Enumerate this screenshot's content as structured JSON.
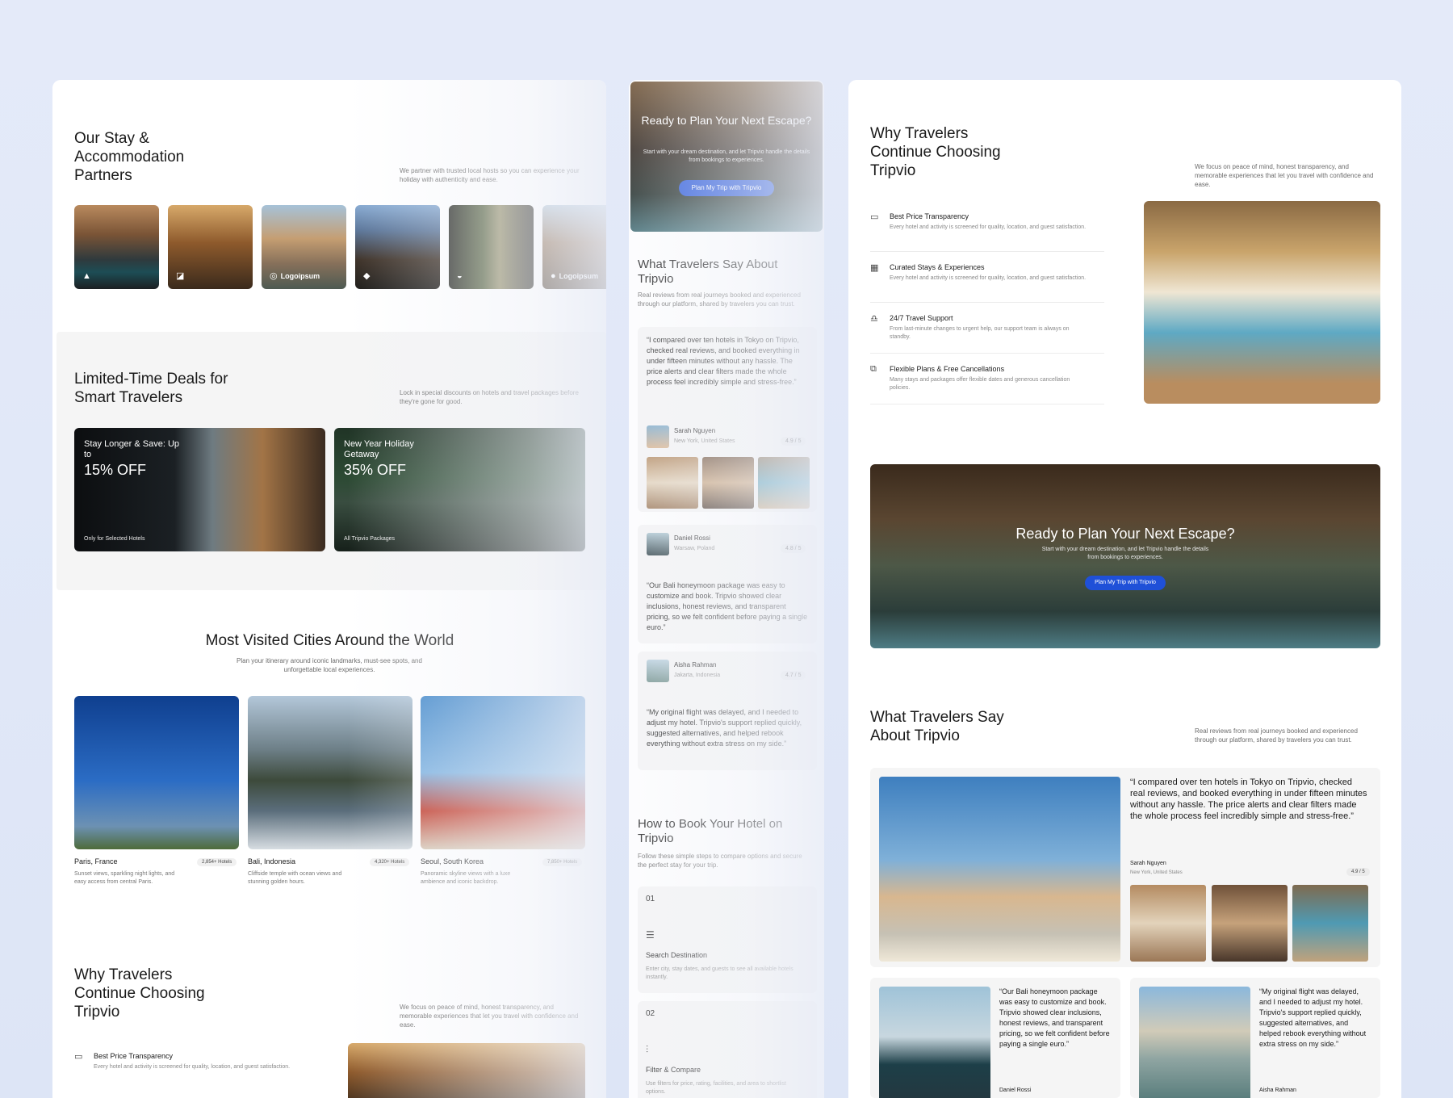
{
  "partners": {
    "title": "Our Stay & Accommodation Partners",
    "desc": "We partner with trusted local hosts so you can experience your holiday with authenticity and ease.",
    "logos": [
      "",
      "",
      "Logoipsum",
      "",
      "",
      "Logoipsum"
    ]
  },
  "deals": {
    "title": "Limited-Time Deals for Smart Travelers",
    "desc": "Lock in special discounts on hotels and travel packages before they're gone for good.",
    "cards": [
      {
        "title": "Stay Longer & Save: Up to",
        "pct": "15% OFF",
        "foot": "Only for Selected Hotels"
      },
      {
        "title": "New Year Holiday Getaway",
        "pct": "35% OFF",
        "foot": "All Tripvio Packages"
      }
    ]
  },
  "cities": {
    "title": "Most Visited Cities Around the World",
    "desc": "Plan your itinerary around iconic landmarks, must-see spots, and unforgettable local experiences.",
    "items": [
      {
        "name": "Paris, France",
        "badge": "2,854+ Hotels",
        "desc": "Sunset views, sparkling night lights, and easy access from central Paris."
      },
      {
        "name": "Bali, Indonesia",
        "badge": "4,320+ Hotels",
        "desc": "Cliffside temple with ocean views and stunning golden hours."
      },
      {
        "name": "Seoul, South Korea",
        "badge": "7,850+ Hotels",
        "desc": "Panoramic skyline views with a luxe ambience and iconic backdrop."
      }
    ]
  },
  "why": {
    "title": "Why Travelers Continue Choosing Tripvio",
    "desc": "We focus on peace of mind, honest transparency, and memorable experiences that let you travel with confidence and ease.",
    "features": [
      {
        "title": "Best Price Transparency",
        "desc": "Every hotel and activity is screened for quality, location, and guest satisfaction.",
        "icon": "cash-icon"
      },
      {
        "title": "Curated Stays & Experiences",
        "desc": "Every hotel and activity is screened for quality, location, and guest satisfaction.",
        "icon": "building-icon"
      },
      {
        "title": "24/7 Travel Support",
        "desc": "From last-minute changes to urgent help, our support team is always on standby.",
        "icon": "headset-icon"
      },
      {
        "title": "Flexible Plans & Free Cancellations",
        "desc": "Many stays and packages offer flexible dates and generous cancellation policies.",
        "icon": "copy-icon"
      }
    ]
  },
  "cta": {
    "title": "Ready to Plan Your Next Escape?",
    "desc": "Start with your dream destination, and let Tripvio handle the details from bookings to experiences.",
    "button": "Plan My Trip with Tripvio"
  },
  "reviews": {
    "title": "What Travelers Say About Tripvio",
    "desc": "Real reviews from real journeys booked and experienced through our platform, shared by travelers you can trust.",
    "items": [
      {
        "quote": "“I compared over ten hotels in Tokyo on Tripvio, checked real reviews, and booked everything in under fifteen minutes without any hassle. The price alerts and clear filters made the whole process feel incredibly simple and stress-free.”",
        "name": "Sarah Nguyen",
        "loc": "New York, United States",
        "rating": "4.9 / 5"
      },
      {
        "quote": "“Our Bali honeymoon package was easy to customize and book. Tripvio showed clear inclusions, honest reviews, and transparent pricing, so we felt confident before paying a single euro.”",
        "name": "Daniel Rossi",
        "loc": "Warsaw, Poland",
        "rating": "4.8 / 5"
      },
      {
        "quote": "“My original flight was delayed, and I needed to adjust my hotel. Tripvio's support replied quickly, suggested alternatives, and helped rebook everything without extra stress on my side.”",
        "name": "Aisha Rahman",
        "loc": "Jakarta, Indonesia",
        "rating": "4.7 / 5"
      }
    ]
  },
  "howto": {
    "title": "How to Book Your Hotel on Tripvio",
    "desc": "Follow these simple steps to compare options and secure the perfect stay for your trip.",
    "steps": [
      {
        "num": "01",
        "title": "Search Destination",
        "desc": "Enter city, stay dates, and guests to see all available hotels instantly."
      },
      {
        "num": "02",
        "title": "Filter & Compare",
        "desc": "Use filters for price, rating, facilities, and area to shortlist options."
      }
    ]
  }
}
